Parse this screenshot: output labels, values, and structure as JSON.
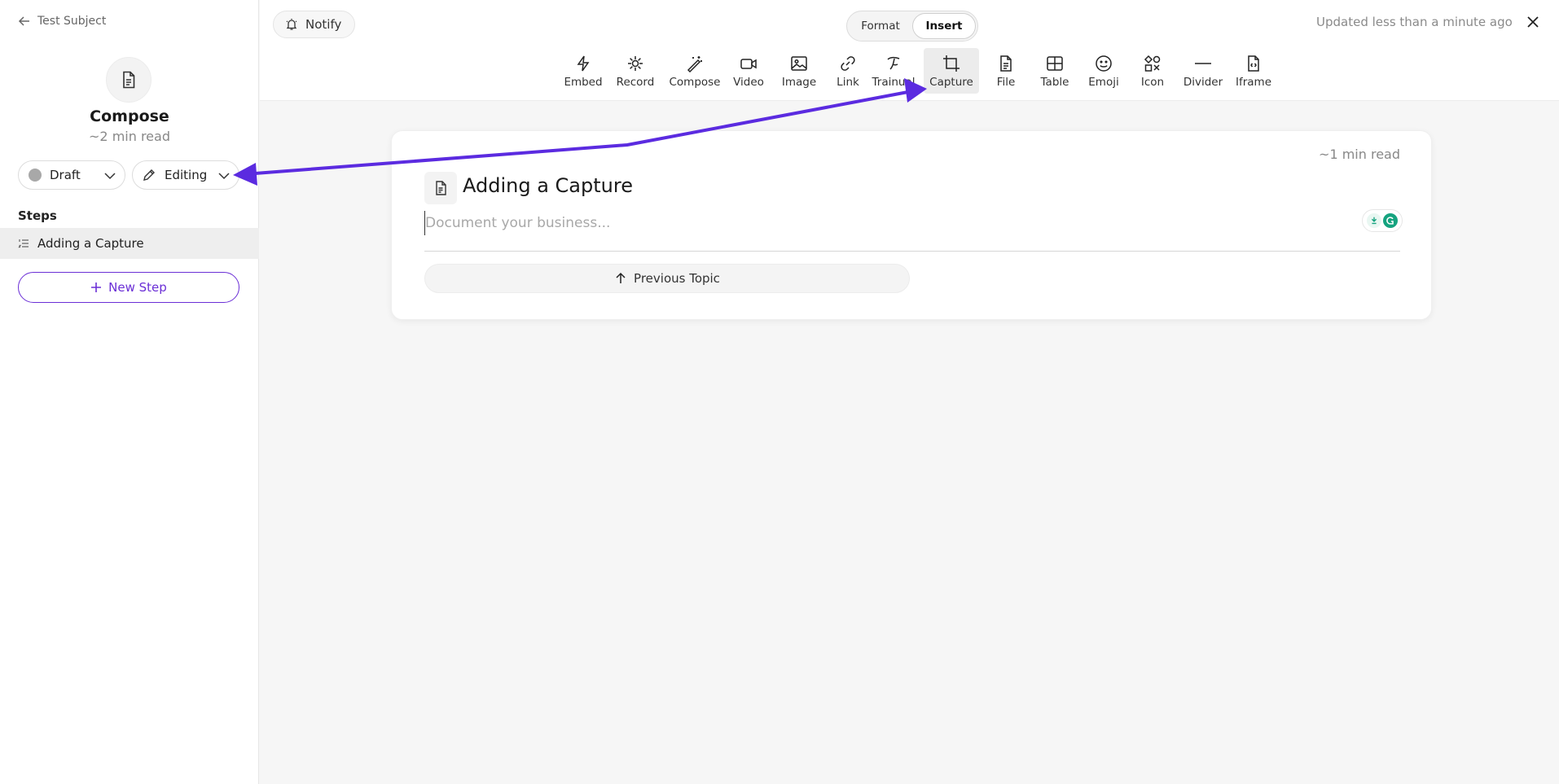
{
  "sidebar": {
    "back_label": "Test Subject",
    "doc_title": "Compose",
    "read_time": "~2 min read",
    "status_dropdown": "Draft",
    "mode_dropdown": "Editing",
    "steps_heading": "Steps",
    "steps": [
      {
        "label": "Adding a Capture",
        "icon": "list-numbered-icon"
      }
    ],
    "new_step_label": "New Step"
  },
  "topbar": {
    "notify_label": "Notify",
    "segments": [
      "Format",
      "Insert"
    ],
    "active_segment": "Insert",
    "updated_text": "Updated less than a minute ago",
    "tools": [
      {
        "label": "Embed",
        "icon": "bolt-icon"
      },
      {
        "label": "Record",
        "icon": "record-icon"
      },
      {
        "label": "Compose",
        "icon": "magic-wand-icon"
      },
      {
        "label": "Video",
        "icon": "video-icon"
      },
      {
        "label": "Image",
        "icon": "image-icon"
      },
      {
        "label": "Link",
        "icon": "link-icon"
      },
      {
        "label": "Trainual",
        "icon": "trainual-icon"
      },
      {
        "label": "Capture",
        "icon": "capture-icon",
        "active": true
      },
      {
        "label": "File",
        "icon": "file-icon"
      },
      {
        "label": "Table",
        "icon": "table-icon"
      },
      {
        "label": "Emoji",
        "icon": "emoji-icon"
      },
      {
        "label": "Icon",
        "icon": "icon-shapes-icon"
      },
      {
        "label": "Divider",
        "icon": "divider-icon"
      },
      {
        "label": "Iframe",
        "icon": "iframe-icon"
      }
    ]
  },
  "editor": {
    "read_time": "~1 min read",
    "step_title": "Adding a Capture",
    "body_placeholder": "Document your business...",
    "body_value": "",
    "previous_topic_label": "Previous Topic"
  },
  "colors": {
    "accent": "#6b2fd6",
    "annotation_arrow": "#5b2be0",
    "grammarly": "#15a37f"
  }
}
